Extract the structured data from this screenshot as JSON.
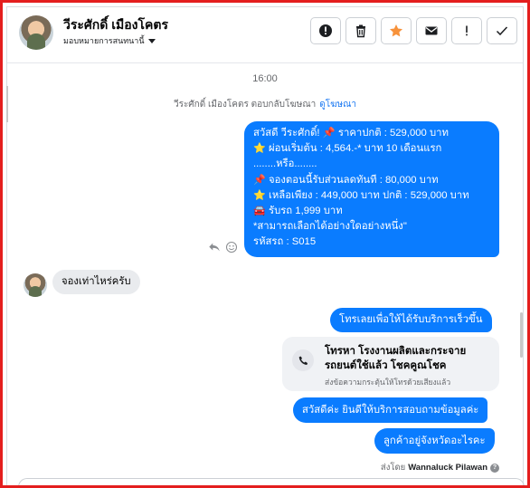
{
  "header": {
    "contact_name": "วีระศักดิ์ เมืองโคตร",
    "assign_label": "มอบหมายการสนทนานี้",
    "actions": [
      {
        "name": "info-button",
        "icon": "alert-circle-icon",
        "glyph": "!"
      },
      {
        "name": "delete-button",
        "icon": "trash-icon"
      },
      {
        "name": "star-button",
        "icon": "star-icon",
        "glyph": "★",
        "color": "#f7923b"
      },
      {
        "name": "mark-unread-button",
        "icon": "envelope-icon"
      },
      {
        "name": "spam-button",
        "icon": "exclamation-icon",
        "glyph": "!"
      },
      {
        "name": "done-button",
        "icon": "check-icon",
        "glyph": "✓"
      }
    ]
  },
  "timestamp": "16:00",
  "notice": {
    "text": "วีระศักดิ์ เมืองโคตร ตอบกลับโฆษณา",
    "link": "ดูโฆษณา"
  },
  "main_message": {
    "lines": [
      {
        "icon": "",
        "text": "สวัสดี วีระศักดิ์! 📌 ราคาปกติ : 529,000 บาท"
      },
      {
        "icon": "⭐",
        "text": "ผ่อนเริ่มต้น : 4,564.-* บาท 10 เดือนแรก"
      },
      {
        "icon": "",
        "text": "........หรือ........"
      },
      {
        "icon": "📌",
        "text": "จองตอนนี้รับส่วนลดทันที : 80,000 บาท"
      },
      {
        "icon": "⭐",
        "text": "เหลือเพียง : 449,000 บาท ปกติ : 529,000 บาท"
      },
      {
        "icon": "🚘",
        "text": "รับรถ 1,999 บาท"
      },
      {
        "icon": "",
        "text": "*สามารถเลือกได้อย่างใดอย่างหนึ่ง\""
      },
      {
        "icon": "",
        "text": "รหัสรถ : S015"
      }
    ]
  },
  "incoming_reply": "จองเท่าไหร่ครับ",
  "outgoing": {
    "msg1": "โทรเลยเพื่อให้ได้รับบริการเร็วขึ้น",
    "call_card": {
      "title": "โทรหา โรงงานผลิตและกระจายรถยนต์ใช้แล้ว โชคคูณโชค",
      "subtitle": "ส่งข้อความกระตุ้นให้โทรด้วยเสียงแล้ว"
    },
    "msg2": "สวัสดีค่ะ  ยินดีให้บริการสอบถามข้อมูลค่ะ",
    "msg3": "ลูกค้าอยู่จังหวัดอะไรคะ"
  },
  "sent_by": {
    "prefix": "ส่งโดย",
    "name": "Wannaluck Pilawan",
    "help": "?"
  },
  "colors": {
    "brand_blue": "#0a7cff",
    "frame_red": "#e41e1e",
    "star_orange": "#f7923b"
  }
}
